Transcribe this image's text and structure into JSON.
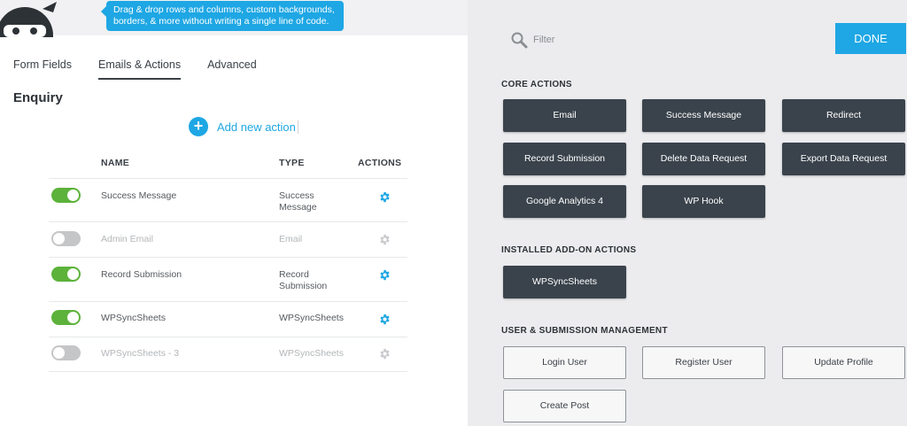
{
  "tooltip": {
    "text": "Drag & drop rows and columns, custom backgrounds, borders, & more without writing a single line of code."
  },
  "tabs": [
    {
      "label": "Form Fields"
    },
    {
      "label": "Emails & Actions"
    },
    {
      "label": "Advanced"
    }
  ],
  "form": {
    "title": "Enquiry"
  },
  "add_action": {
    "label": "Add new action"
  },
  "table": {
    "headers": {
      "name": "NAME",
      "type": "TYPE",
      "actions": "ACTIONS"
    },
    "rows": [
      {
        "name": "Success Message",
        "type": "Success Message",
        "enabled": true
      },
      {
        "name": "Admin Email",
        "type": "Email",
        "enabled": false
      },
      {
        "name": "Record Submission",
        "type": "Record Submission",
        "enabled": true
      },
      {
        "name": "WPSyncSheets",
        "type": "WPSyncSheets",
        "enabled": true
      },
      {
        "name": "WPSyncSheets - 3",
        "type": "WPSyncSheets",
        "enabled": false
      }
    ]
  },
  "panel": {
    "filter_placeholder": "Filter",
    "done_label": "DONE",
    "sections": {
      "core": {
        "title": "CORE ACTIONS",
        "buttons": [
          "Email",
          "Success Message",
          "Redirect",
          "Record Submission",
          "Delete Data Request",
          "Export Data Request",
          "Google Analytics 4",
          "WP Hook"
        ]
      },
      "addons": {
        "title": "INSTALLED ADD-ON ACTIONS",
        "buttons": [
          "WPSyncSheets"
        ]
      },
      "user": {
        "title": "USER & SUBMISSION MANAGEMENT",
        "buttons": [
          "Login User",
          "Register User",
          "Update Profile",
          "Create Post"
        ]
      }
    }
  },
  "colors": {
    "accent": "#1ea7e4",
    "toggle_on": "#5cb23a",
    "toggle_off": "#c5c6c8",
    "button_dark": "#3a434c"
  },
  "icons": {
    "mascot": "ninja-mascot-icon",
    "add": "plus-circle-icon",
    "settings": "gear-icon",
    "filter": "search-icon"
  }
}
